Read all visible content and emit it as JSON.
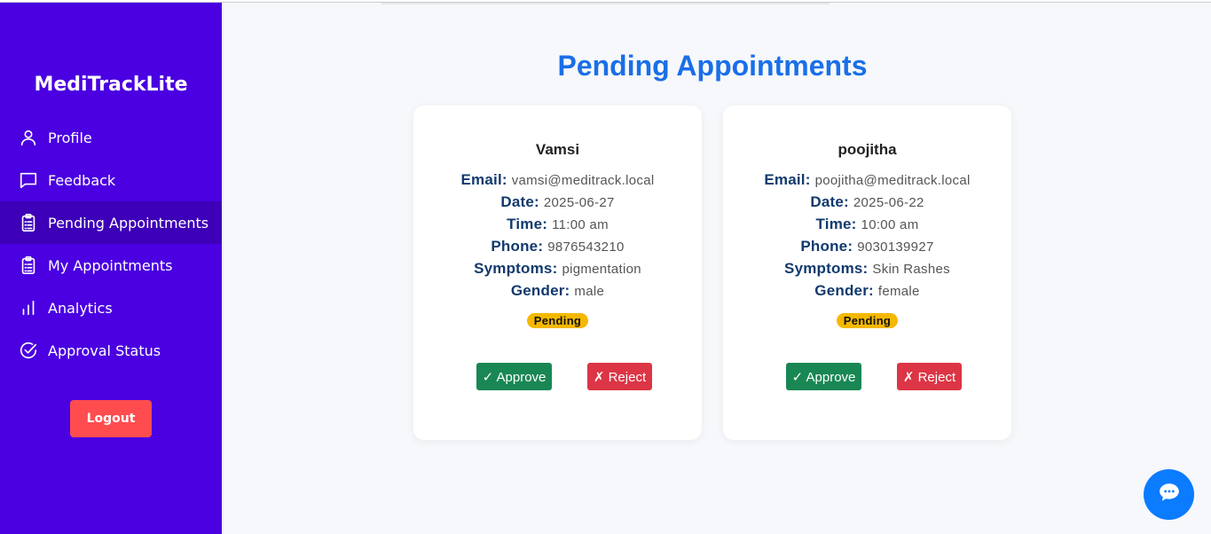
{
  "sidebar": {
    "brand": "MediTrackLite",
    "items": [
      {
        "label": "Profile",
        "icon": "user-icon"
      },
      {
        "label": "Feedback",
        "icon": "message-icon"
      },
      {
        "label": "Pending Appointments",
        "icon": "clipboard-icon",
        "active": true
      },
      {
        "label": "My Appointments",
        "icon": "clipboard-icon"
      },
      {
        "label": "Analytics",
        "icon": "bar-chart-icon"
      },
      {
        "label": "Approval Status",
        "icon": "check-circle-icon"
      }
    ],
    "logout_label": "Logout"
  },
  "main": {
    "title": "Pending Appointments",
    "labels": {
      "email": "Email:",
      "date": "Date:",
      "time": "Time:",
      "phone": "Phone:",
      "symptoms": "Symptoms:",
      "gender": "Gender:"
    },
    "appointments": [
      {
        "name": "Vamsi",
        "email": "vamsi@meditrack.local",
        "date": "2025-06-27",
        "time": "11:00 am",
        "phone": "9876543210",
        "symptoms": "pigmentation",
        "gender": "male",
        "status": "Pending",
        "approve_label": "✓ Approve",
        "reject_label": "✗ Reject"
      },
      {
        "name": "poojitha",
        "email": "poojitha@meditrack.local",
        "date": "2025-06-22",
        "time": "10:00 am",
        "phone": "9030139927",
        "symptoms": "Skin Rashes",
        "gender": "female",
        "status": "Pending",
        "approve_label": "✓ Approve",
        "reject_label": "✗ Reject"
      }
    ]
  },
  "colors": {
    "sidebar": "#4a00e0",
    "sidebar_active": "#3d00b8",
    "title": "#1a6fe8",
    "approve": "#198754",
    "reject": "#dc3545",
    "badge": "#f5b800",
    "logout": "#ff4d4f",
    "chat_fab": "#0b7bff"
  },
  "chat": {
    "icon": "chat-bubble-icon"
  }
}
